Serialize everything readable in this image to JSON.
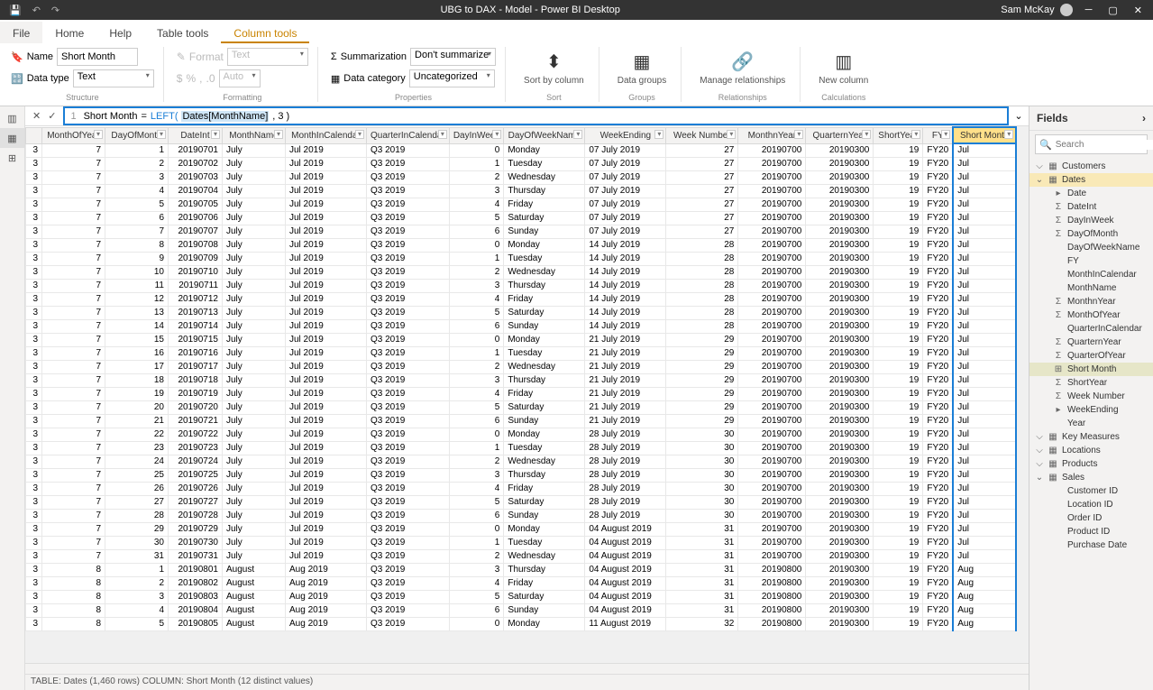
{
  "title_bar": {
    "title": "UBG to DAX - Model - Power BI Desktop",
    "user": "Sam McKay"
  },
  "tabs": {
    "file": "File",
    "home": "Home",
    "help": "Help",
    "table_tools": "Table tools",
    "column_tools": "Column tools"
  },
  "ribbon": {
    "name_label": "Name",
    "name_value": "Short Month",
    "datatype_label": "Data type",
    "datatype_value": "Text",
    "format_label": "Format",
    "format_value": "Text",
    "auto": "Auto",
    "summarization_label": "Summarization",
    "summarization_value": "Don't summarize",
    "category_label": "Data category",
    "category_value": "Uncategorized",
    "sort_btn": "Sort by\ncolumn",
    "data_groups_btn": "Data\ngroups",
    "manage_rel_btn": "Manage\nrelationships",
    "new_column_btn": "New\ncolumn",
    "grp_structure": "Structure",
    "grp_formatting": "Formatting",
    "grp_properties": "Properties",
    "grp_sort": "Sort",
    "grp_groups": "Groups",
    "grp_rel": "Relationships",
    "grp_calc": "Calculations"
  },
  "formula": {
    "line": "1",
    "col": "Short Month",
    "eq": "=",
    "fn": "LEFT(",
    "arg": "Dates[MonthName]",
    "rest": ", 3 )"
  },
  "columns": [
    "",
    "MonthOfYear",
    "DayOfMonth",
    "DateInt",
    "MonthName",
    "MonthInCalendar",
    "QuarterInCalendar",
    "DayInWeek",
    "DayOfWeekName",
    "WeekEnding",
    "Week Number",
    "MonthnYear",
    "QuarternYear",
    "ShortYear",
    "FY",
    "Short Month"
  ],
  "rows": [
    [
      "3",
      "7",
      "1",
      "20190701",
      "July",
      "Jul 2019",
      "Q3 2019",
      "0",
      "Monday",
      "07 July 2019",
      "27",
      "20190700",
      "20190300",
      "19",
      "FY20",
      "Jul"
    ],
    [
      "3",
      "7",
      "2",
      "20190702",
      "July",
      "Jul 2019",
      "Q3 2019",
      "1",
      "Tuesday",
      "07 July 2019",
      "27",
      "20190700",
      "20190300",
      "19",
      "FY20",
      "Jul"
    ],
    [
      "3",
      "7",
      "3",
      "20190703",
      "July",
      "Jul 2019",
      "Q3 2019",
      "2",
      "Wednesday",
      "07 July 2019",
      "27",
      "20190700",
      "20190300",
      "19",
      "FY20",
      "Jul"
    ],
    [
      "3",
      "7",
      "4",
      "20190704",
      "July",
      "Jul 2019",
      "Q3 2019",
      "3",
      "Thursday",
      "07 July 2019",
      "27",
      "20190700",
      "20190300",
      "19",
      "FY20",
      "Jul"
    ],
    [
      "3",
      "7",
      "5",
      "20190705",
      "July",
      "Jul 2019",
      "Q3 2019",
      "4",
      "Friday",
      "07 July 2019",
      "27",
      "20190700",
      "20190300",
      "19",
      "FY20",
      "Jul"
    ],
    [
      "3",
      "7",
      "6",
      "20190706",
      "July",
      "Jul 2019",
      "Q3 2019",
      "5",
      "Saturday",
      "07 July 2019",
      "27",
      "20190700",
      "20190300",
      "19",
      "FY20",
      "Jul"
    ],
    [
      "3",
      "7",
      "7",
      "20190707",
      "July",
      "Jul 2019",
      "Q3 2019",
      "6",
      "Sunday",
      "07 July 2019",
      "27",
      "20190700",
      "20190300",
      "19",
      "FY20",
      "Jul"
    ],
    [
      "3",
      "7",
      "8",
      "20190708",
      "July",
      "Jul 2019",
      "Q3 2019",
      "0",
      "Monday",
      "14 July 2019",
      "28",
      "20190700",
      "20190300",
      "19",
      "FY20",
      "Jul"
    ],
    [
      "3",
      "7",
      "9",
      "20190709",
      "July",
      "Jul 2019",
      "Q3 2019",
      "1",
      "Tuesday",
      "14 July 2019",
      "28",
      "20190700",
      "20190300",
      "19",
      "FY20",
      "Jul"
    ],
    [
      "3",
      "7",
      "10",
      "20190710",
      "July",
      "Jul 2019",
      "Q3 2019",
      "2",
      "Wednesday",
      "14 July 2019",
      "28",
      "20190700",
      "20190300",
      "19",
      "FY20",
      "Jul"
    ],
    [
      "3",
      "7",
      "11",
      "20190711",
      "July",
      "Jul 2019",
      "Q3 2019",
      "3",
      "Thursday",
      "14 July 2019",
      "28",
      "20190700",
      "20190300",
      "19",
      "FY20",
      "Jul"
    ],
    [
      "3",
      "7",
      "12",
      "20190712",
      "July",
      "Jul 2019",
      "Q3 2019",
      "4",
      "Friday",
      "14 July 2019",
      "28",
      "20190700",
      "20190300",
      "19",
      "FY20",
      "Jul"
    ],
    [
      "3",
      "7",
      "13",
      "20190713",
      "July",
      "Jul 2019",
      "Q3 2019",
      "5",
      "Saturday",
      "14 July 2019",
      "28",
      "20190700",
      "20190300",
      "19",
      "FY20",
      "Jul"
    ],
    [
      "3",
      "7",
      "14",
      "20190714",
      "July",
      "Jul 2019",
      "Q3 2019",
      "6",
      "Sunday",
      "14 July 2019",
      "28",
      "20190700",
      "20190300",
      "19",
      "FY20",
      "Jul"
    ],
    [
      "3",
      "7",
      "15",
      "20190715",
      "July",
      "Jul 2019",
      "Q3 2019",
      "0",
      "Monday",
      "21 July 2019",
      "29",
      "20190700",
      "20190300",
      "19",
      "FY20",
      "Jul"
    ],
    [
      "3",
      "7",
      "16",
      "20190716",
      "July",
      "Jul 2019",
      "Q3 2019",
      "1",
      "Tuesday",
      "21 July 2019",
      "29",
      "20190700",
      "20190300",
      "19",
      "FY20",
      "Jul"
    ],
    [
      "3",
      "7",
      "17",
      "20190717",
      "July",
      "Jul 2019",
      "Q3 2019",
      "2",
      "Wednesday",
      "21 July 2019",
      "29",
      "20190700",
      "20190300",
      "19",
      "FY20",
      "Jul"
    ],
    [
      "3",
      "7",
      "18",
      "20190718",
      "July",
      "Jul 2019",
      "Q3 2019",
      "3",
      "Thursday",
      "21 July 2019",
      "29",
      "20190700",
      "20190300",
      "19",
      "FY20",
      "Jul"
    ],
    [
      "3",
      "7",
      "19",
      "20190719",
      "July",
      "Jul 2019",
      "Q3 2019",
      "4",
      "Friday",
      "21 July 2019",
      "29",
      "20190700",
      "20190300",
      "19",
      "FY20",
      "Jul"
    ],
    [
      "3",
      "7",
      "20",
      "20190720",
      "July",
      "Jul 2019",
      "Q3 2019",
      "5",
      "Saturday",
      "21 July 2019",
      "29",
      "20190700",
      "20190300",
      "19",
      "FY20",
      "Jul"
    ],
    [
      "3",
      "7",
      "21",
      "20190721",
      "July",
      "Jul 2019",
      "Q3 2019",
      "6",
      "Sunday",
      "21 July 2019",
      "29",
      "20190700",
      "20190300",
      "19",
      "FY20",
      "Jul"
    ],
    [
      "3",
      "7",
      "22",
      "20190722",
      "July",
      "Jul 2019",
      "Q3 2019",
      "0",
      "Monday",
      "28 July 2019",
      "30",
      "20190700",
      "20190300",
      "19",
      "FY20",
      "Jul"
    ],
    [
      "3",
      "7",
      "23",
      "20190723",
      "July",
      "Jul 2019",
      "Q3 2019",
      "1",
      "Tuesday",
      "28 July 2019",
      "30",
      "20190700",
      "20190300",
      "19",
      "FY20",
      "Jul"
    ],
    [
      "3",
      "7",
      "24",
      "20190724",
      "July",
      "Jul 2019",
      "Q3 2019",
      "2",
      "Wednesday",
      "28 July 2019",
      "30",
      "20190700",
      "20190300",
      "19",
      "FY20",
      "Jul"
    ],
    [
      "3",
      "7",
      "25",
      "20190725",
      "July",
      "Jul 2019",
      "Q3 2019",
      "3",
      "Thursday",
      "28 July 2019",
      "30",
      "20190700",
      "20190300",
      "19",
      "FY20",
      "Jul"
    ],
    [
      "3",
      "7",
      "26",
      "20190726",
      "July",
      "Jul 2019",
      "Q3 2019",
      "4",
      "Friday",
      "28 July 2019",
      "30",
      "20190700",
      "20190300",
      "19",
      "FY20",
      "Jul"
    ],
    [
      "3",
      "7",
      "27",
      "20190727",
      "July",
      "Jul 2019",
      "Q3 2019",
      "5",
      "Saturday",
      "28 July 2019",
      "30",
      "20190700",
      "20190300",
      "19",
      "FY20",
      "Jul"
    ],
    [
      "3",
      "7",
      "28",
      "20190728",
      "July",
      "Jul 2019",
      "Q3 2019",
      "6",
      "Sunday",
      "28 July 2019",
      "30",
      "20190700",
      "20190300",
      "19",
      "FY20",
      "Jul"
    ],
    [
      "3",
      "7",
      "29",
      "20190729",
      "July",
      "Jul 2019",
      "Q3 2019",
      "0",
      "Monday",
      "04 August 2019",
      "31",
      "20190700",
      "20190300",
      "19",
      "FY20",
      "Jul"
    ],
    [
      "3",
      "7",
      "30",
      "20190730",
      "July",
      "Jul 2019",
      "Q3 2019",
      "1",
      "Tuesday",
      "04 August 2019",
      "31",
      "20190700",
      "20190300",
      "19",
      "FY20",
      "Jul"
    ],
    [
      "3",
      "7",
      "31",
      "20190731",
      "July",
      "Jul 2019",
      "Q3 2019",
      "2",
      "Wednesday",
      "04 August 2019",
      "31",
      "20190700",
      "20190300",
      "19",
      "FY20",
      "Jul"
    ],
    [
      "3",
      "8",
      "1",
      "20190801",
      "August",
      "Aug 2019",
      "Q3 2019",
      "3",
      "Thursday",
      "04 August 2019",
      "31",
      "20190800",
      "20190300",
      "19",
      "FY20",
      "Aug"
    ],
    [
      "3",
      "8",
      "2",
      "20190802",
      "August",
      "Aug 2019",
      "Q3 2019",
      "4",
      "Friday",
      "04 August 2019",
      "31",
      "20190800",
      "20190300",
      "19",
      "FY20",
      "Aug"
    ],
    [
      "3",
      "8",
      "3",
      "20190803",
      "August",
      "Aug 2019",
      "Q3 2019",
      "5",
      "Saturday",
      "04 August 2019",
      "31",
      "20190800",
      "20190300",
      "19",
      "FY20",
      "Aug"
    ],
    [
      "3",
      "8",
      "4",
      "20190804",
      "August",
      "Aug 2019",
      "Q3 2019",
      "6",
      "Sunday",
      "04 August 2019",
      "31",
      "20190800",
      "20190300",
      "19",
      "FY20",
      "Aug"
    ],
    [
      "3",
      "8",
      "5",
      "20190805",
      "August",
      "Aug 2019",
      "Q3 2019",
      "0",
      "Monday",
      "11 August 2019",
      "32",
      "20190800",
      "20190300",
      "19",
      "FY20",
      "Aug"
    ]
  ],
  "fields": {
    "header": "Fields",
    "search_placeholder": "Search",
    "tables": [
      {
        "name": "Customers",
        "expanded": false
      },
      {
        "name": "Dates",
        "expanded": true,
        "highlighted": true,
        "cols": [
          {
            "name": "Date",
            "icon": "▸",
            "sigma": false
          },
          {
            "name": "DateInt",
            "sigma": true
          },
          {
            "name": "DayInWeek",
            "sigma": true
          },
          {
            "name": "DayOfMonth",
            "sigma": true
          },
          {
            "name": "DayOfWeekName"
          },
          {
            "name": "FY"
          },
          {
            "name": "MonthInCalendar"
          },
          {
            "name": "MonthName"
          },
          {
            "name": "MonthnYear",
            "sigma": true
          },
          {
            "name": "MonthOfYear",
            "sigma": true
          },
          {
            "name": "QuarterInCalendar"
          },
          {
            "name": "QuarternYear",
            "sigma": true
          },
          {
            "name": "QuarterOfYear",
            "sigma": true
          },
          {
            "name": "Short Month",
            "selected": true,
            "calc": true
          },
          {
            "name": "ShortYear",
            "sigma": true
          },
          {
            "name": "Week Number",
            "sigma": true
          },
          {
            "name": "WeekEnding",
            "icon": "▸"
          },
          {
            "name": "Year"
          }
        ]
      },
      {
        "name": "Key Measures",
        "expanded": false
      },
      {
        "name": "Locations",
        "expanded": false
      },
      {
        "name": "Products",
        "expanded": false
      },
      {
        "name": "Sales",
        "expanded": true,
        "cols": [
          {
            "name": "Customer ID"
          },
          {
            "name": "Location ID"
          },
          {
            "name": "Order ID"
          },
          {
            "name": "Product ID"
          },
          {
            "name": "Purchase Date"
          }
        ]
      }
    ]
  },
  "status": "TABLE: Dates (1,460 rows)  COLUMN: Short Month (12 distinct values)"
}
